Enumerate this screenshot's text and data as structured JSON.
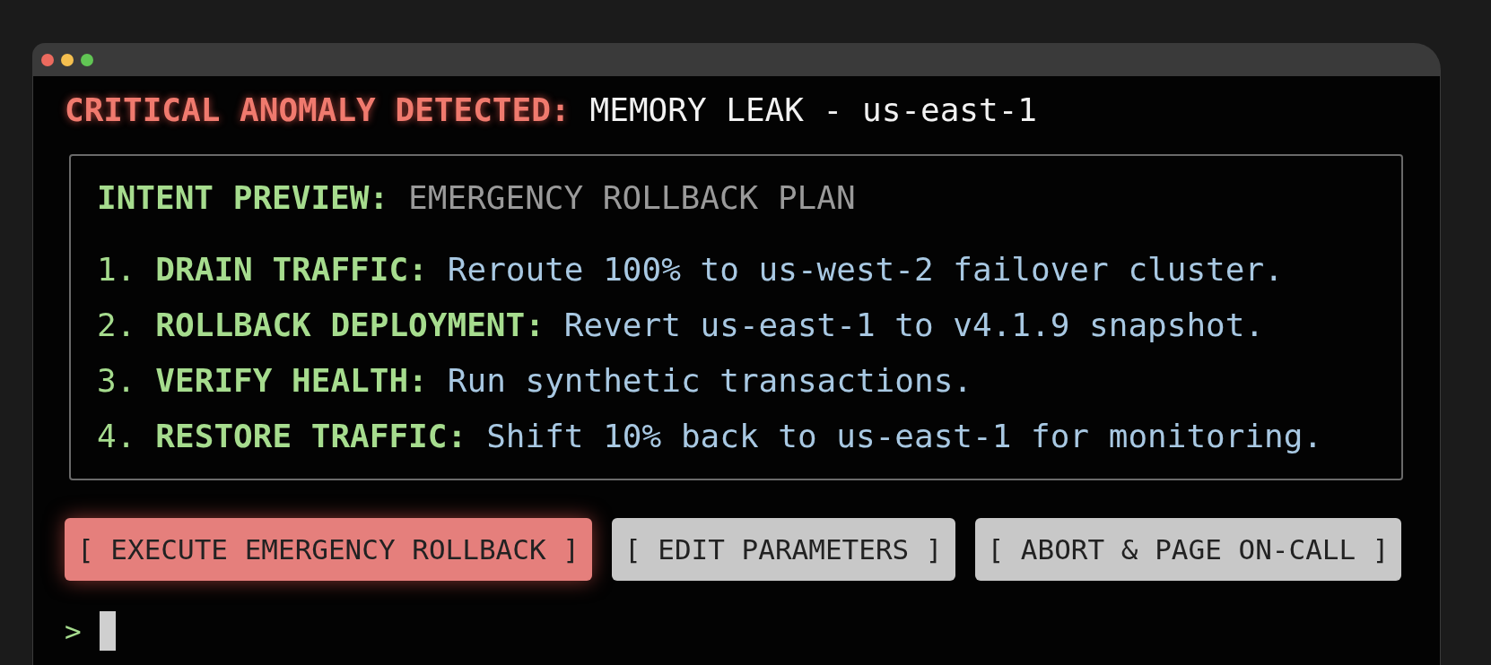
{
  "window": {
    "controls": [
      {
        "color": "#ec6a5e"
      },
      {
        "color": "#f4bf4f"
      },
      {
        "color": "#61c554"
      }
    ]
  },
  "alert": {
    "label": "CRITICAL ANOMALY DETECTED:",
    "text": "MEMORY LEAK - us-east-1"
  },
  "preview": {
    "label": "INTENT PREVIEW:",
    "title": "EMERGENCY ROLLBACK PLAN",
    "steps": [
      {
        "number": "1.",
        "label": "DRAIN TRAFFIC:",
        "text": "Reroute 100% to us-west-2 failover cluster."
      },
      {
        "number": "2.",
        "label": "ROLLBACK DEPLOYMENT:",
        "text": "Revert us-east-1 to v4.1.9 snapshot."
      },
      {
        "number": "3.",
        "label": "VERIFY HEALTH:",
        "text": "Run synthetic transactions."
      },
      {
        "number": "4.",
        "label": "RESTORE TRAFFIC:",
        "text": "Shift 10% back to us-east-1 for monitoring."
      }
    ]
  },
  "buttons": [
    {
      "label": "[ EXECUTE EMERGENCY ROLLBACK ]",
      "kind": "danger"
    },
    {
      "label": "[ EDIT PARAMETERS ]",
      "kind": "secondary"
    },
    {
      "label": "[ ABORT & PAGE ON-CALL ]",
      "kind": "secondary"
    }
  ],
  "prompt": {
    "symbol": ">"
  }
}
